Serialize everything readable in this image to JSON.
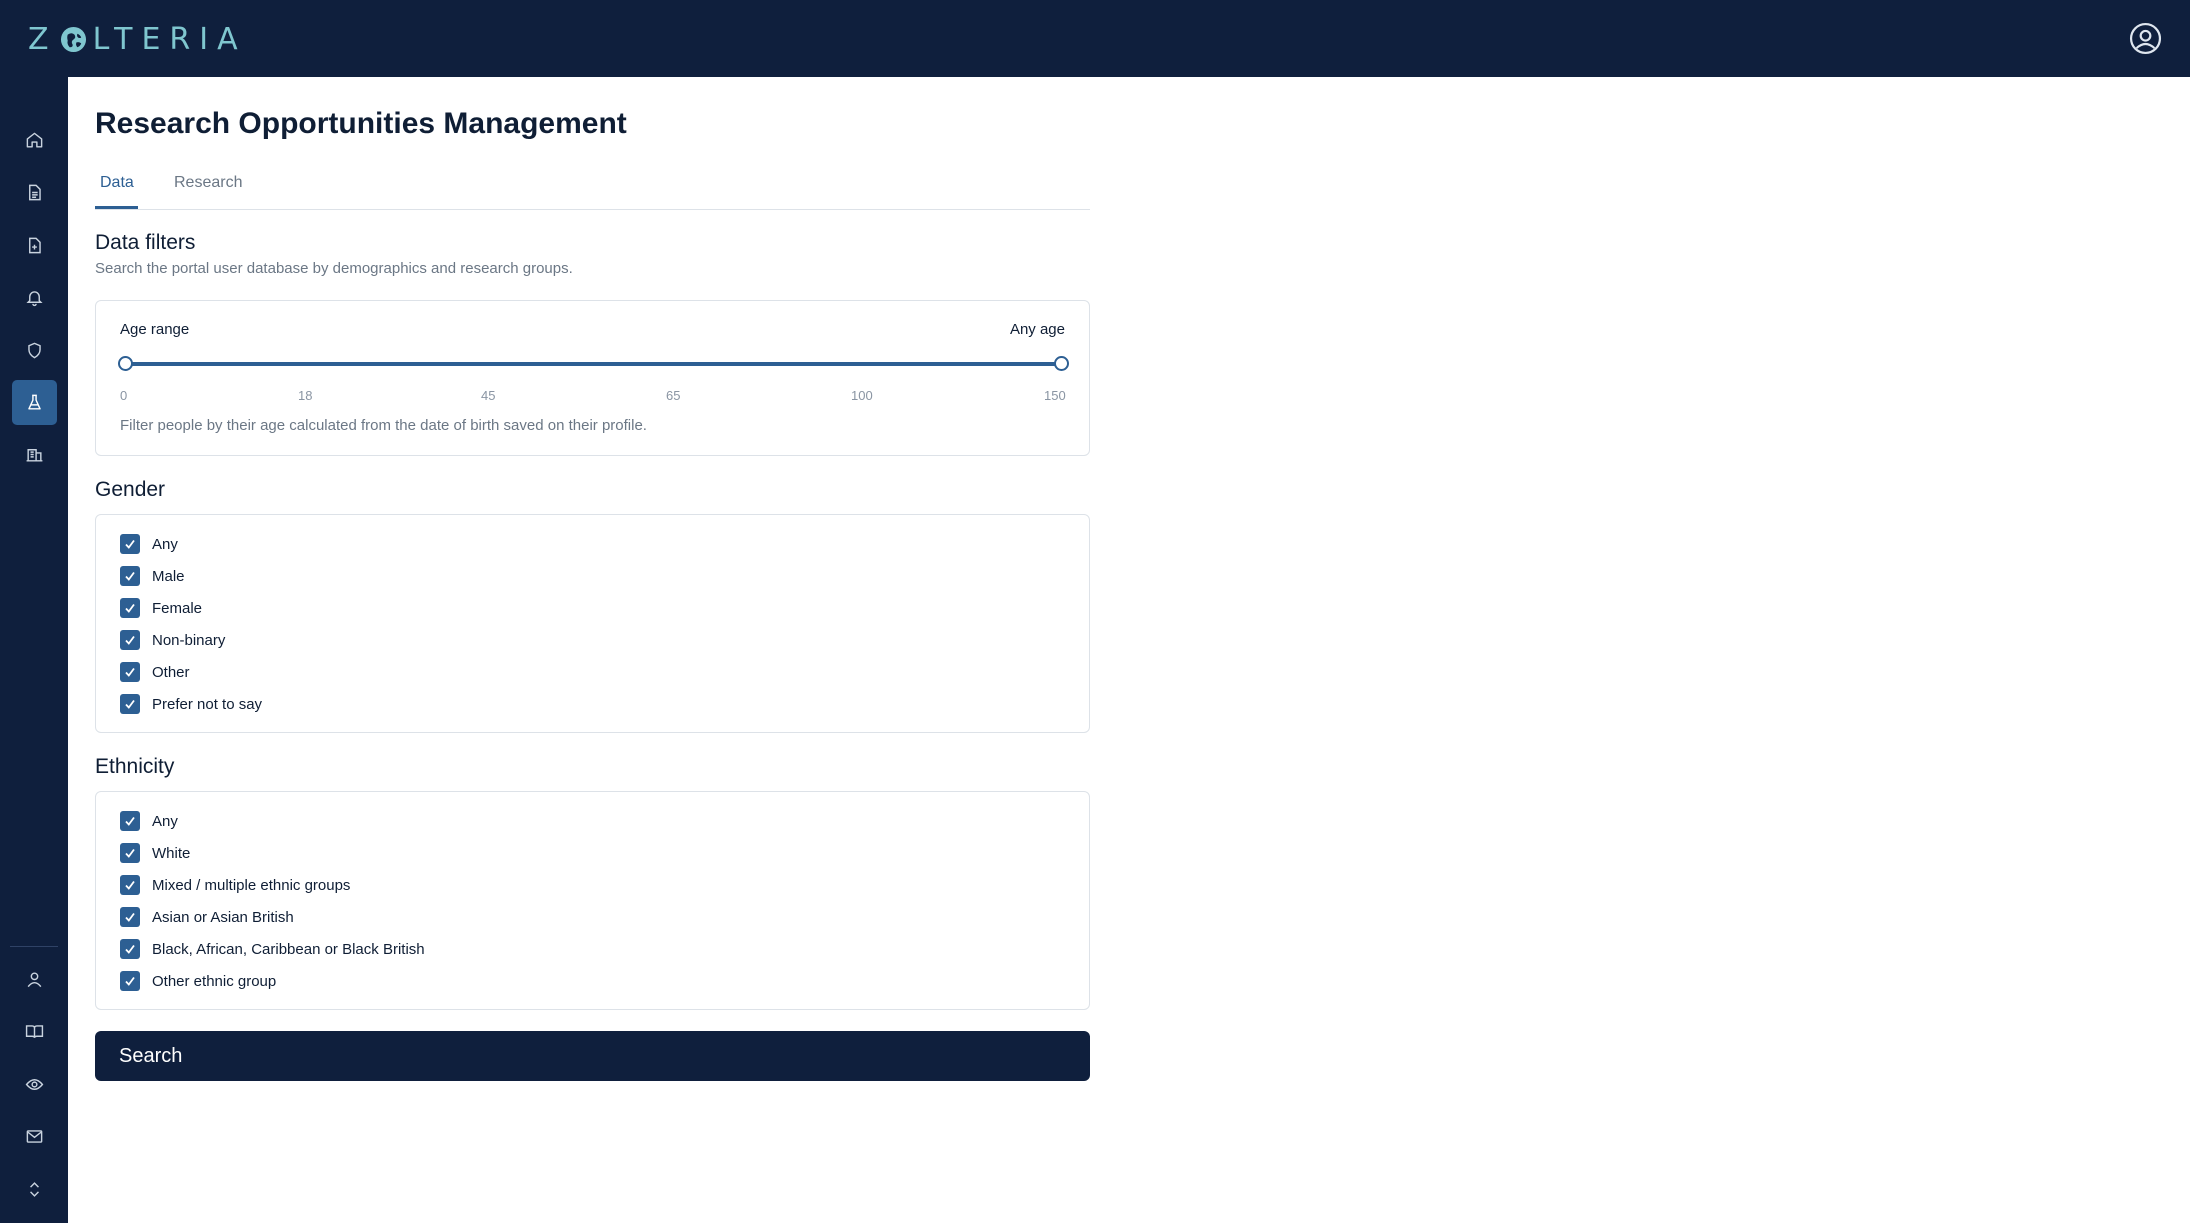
{
  "app": {
    "logo_text_left": "Z",
    "logo_text_right": "LTERIA"
  },
  "colors": {
    "brand_dark": "#0f1f3d",
    "accent": "#2d5f93",
    "logo": "#7fc6cf"
  },
  "sidebar": {
    "top_items": [
      {
        "icon": "home-icon",
        "active": false
      },
      {
        "icon": "document-icon",
        "active": false
      },
      {
        "icon": "file-add-icon",
        "active": false
      },
      {
        "icon": "bell-icon",
        "active": false
      },
      {
        "icon": "shield-icon",
        "active": false
      },
      {
        "icon": "flask-icon",
        "active": true
      },
      {
        "icon": "building-icon",
        "active": false
      }
    ],
    "bottom_items": [
      {
        "icon": "user-icon"
      },
      {
        "icon": "book-icon"
      },
      {
        "icon": "eye-icon"
      },
      {
        "icon": "mail-icon"
      },
      {
        "icon": "chevron-up-down-icon"
      }
    ]
  },
  "page": {
    "title": "Research Opportunities Management"
  },
  "tabs": [
    {
      "label": "Data",
      "active": true
    },
    {
      "label": "Research",
      "active": false
    }
  ],
  "filters": {
    "title": "Data filters",
    "description": "Search the portal user database by demographics and research groups.",
    "age": {
      "label": "Age range",
      "value_text": "Any age",
      "min": 0,
      "max": 150,
      "selected_min": 0,
      "selected_max": 150,
      "ticks": [
        "0",
        "18",
        "45",
        "65",
        "100",
        "150"
      ],
      "help": "Filter people by their age calculated from the date of birth saved on their profile."
    }
  },
  "gender": {
    "title": "Gender",
    "options": [
      {
        "label": "Any",
        "checked": true
      },
      {
        "label": "Male",
        "checked": true
      },
      {
        "label": "Female",
        "checked": true
      },
      {
        "label": "Non-binary",
        "checked": true
      },
      {
        "label": "Other",
        "checked": true
      },
      {
        "label": "Prefer not to say",
        "checked": true
      }
    ]
  },
  "ethnicity": {
    "title": "Ethnicity",
    "options": [
      {
        "label": "Any",
        "checked": true
      },
      {
        "label": "White",
        "checked": true
      },
      {
        "label": "Mixed / multiple ethnic groups",
        "checked": true
      },
      {
        "label": "Asian or Asian British",
        "checked": true
      },
      {
        "label": "Black, African, Caribbean or Black British",
        "checked": true
      },
      {
        "label": "Other ethnic group",
        "checked": true
      }
    ]
  },
  "actions": {
    "search_label": "Search"
  }
}
